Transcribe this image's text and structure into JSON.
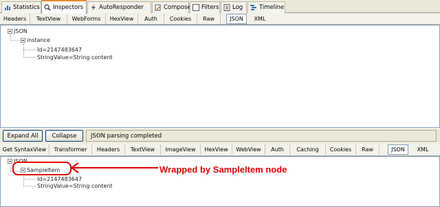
{
  "main_tabs": [
    {
      "label": "Statistics",
      "icon": "statistics-icon"
    },
    {
      "label": "Inspectors",
      "icon": "inspectors-icon"
    },
    {
      "label": "AutoResponder",
      "icon": "lightning-icon"
    },
    {
      "label": "Composer",
      "icon": "composer-icon"
    },
    {
      "label": "Filters",
      "icon": "checkbox-icon"
    },
    {
      "label": "Log",
      "icon": "log-icon"
    },
    {
      "label": "Timeline",
      "icon": "timeline-icon"
    }
  ],
  "request_tabs": [
    "Headers",
    "TextView",
    "WebForms",
    "HexView",
    "Auth",
    "Cookies",
    "Raw",
    "JSON",
    "XML"
  ],
  "request_tree": {
    "root": "JSON",
    "node": "instance",
    "leaves": [
      "Id=2147483647",
      "StringValue=String content"
    ]
  },
  "toolbar": {
    "expand_all": "Expand All",
    "collapse": "Collapse",
    "status": "JSON parsing completed"
  },
  "response_tabs": [
    "Get SyntaxView",
    "Transformer",
    "Headers",
    "TextView",
    "ImageView",
    "HexView",
    "WebView",
    "Auth",
    "Caching",
    "Cookies",
    "Raw",
    "JSON",
    "XML"
  ],
  "response_tree": {
    "root": "JSON",
    "node": "SampleItem",
    "leaves": [
      "Id=2147483647",
      "StringValue=String content"
    ]
  },
  "annotation": "Wrapped by SampleItem node",
  "colors": {
    "annotation": "#e00000",
    "active_tab_accent": "#e68b2c"
  }
}
